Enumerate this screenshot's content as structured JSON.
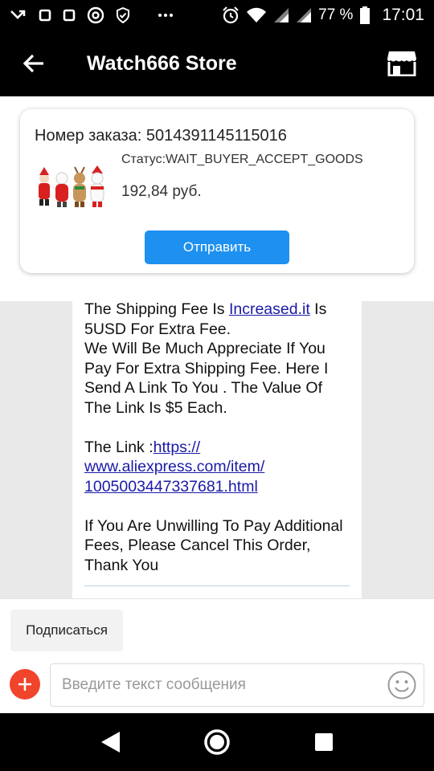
{
  "status_bar": {
    "battery_percent": "77 %",
    "time": "17:01",
    "icons": [
      "missed-call-icon",
      "stop-icon",
      "stop-icon",
      "at-sign-icon",
      "shield-check-icon",
      "more-dots-icon",
      "alarm-icon",
      "wifi-icon",
      "signal-icon",
      "signal-icon",
      "battery-icon"
    ]
  },
  "app_bar": {
    "title": "Watch666 Store",
    "back_icon": "arrow-back-icon",
    "store_icon": "store-icon"
  },
  "order": {
    "number_label": "Номер заказа: 5014391145115016",
    "status": "Статус:WAIT_BUYER_ACCEPT_GOODS",
    "price": "192,84 руб.",
    "send_label": "Отправить"
  },
  "message": {
    "line1_prefix": "The Shipping Fee Is ",
    "line1_link": "Increased.it",
    "line1_suffix": " Is 5USD For Extra Fee.",
    "line2": "We Will Be Much Appreciate If You Pay For Extra Shipping Fee. Here I Send A Link To You . The Value Of The Link Is $5 Each.",
    "link_label": "The Link :",
    "link_url": "https:// www.aliexpress.com/item/ 1005003447337681.html",
    "line3": "If You Are Unwilling To Pay Additional Fees, Please Cancel This Order, Thank You"
  },
  "bottom": {
    "subscribe_label": "Подписаться",
    "input_placeholder": "Введите текст сообщения",
    "input_value": ""
  },
  "accent_colors": {
    "send_button": "#1e90f0",
    "add_button": "#f0442b",
    "link": "#1a1aa8"
  }
}
